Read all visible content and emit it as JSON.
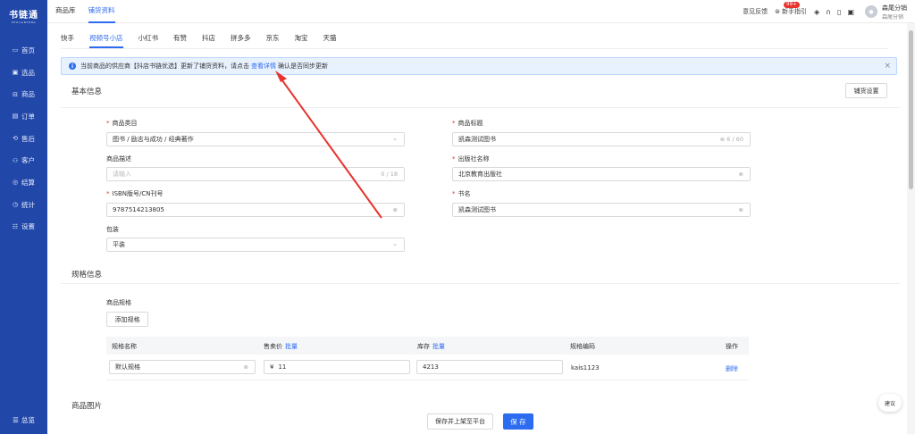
{
  "sidebar": {
    "logo": "书链通",
    "logo_sub": "SHULIANTONG",
    "items": [
      {
        "icon": "monitor-icon",
        "glyph": "▭",
        "label": "首页"
      },
      {
        "icon": "select-icon",
        "glyph": "▣",
        "label": "选品"
      },
      {
        "icon": "goods-icon",
        "glyph": "⊟",
        "label": "商品"
      },
      {
        "icon": "order-icon",
        "glyph": "▤",
        "label": "订单"
      },
      {
        "icon": "aftersale-icon",
        "glyph": "⟲",
        "label": "售后"
      },
      {
        "icon": "customer-icon",
        "glyph": "⚇",
        "label": "客户"
      },
      {
        "icon": "settle-icon",
        "glyph": "◎",
        "label": "结算"
      },
      {
        "icon": "stats-icon",
        "glyph": "◷",
        "label": "统计"
      },
      {
        "icon": "settings-icon",
        "glyph": "☷",
        "label": "设置"
      }
    ],
    "bottom": {
      "icon": "menu-icon",
      "glyph": "☰",
      "label": "总览"
    }
  },
  "topbar": {
    "nav": [
      "商品库",
      "铺货资料"
    ],
    "feedback": "意见反馈",
    "guide": "新手指引",
    "badge": "99+",
    "user_name": "森尾分销",
    "user_role": "森尾分销"
  },
  "tabs": [
    "快手",
    "视频号小店",
    "小红书",
    "有赞",
    "抖店",
    "拼多多",
    "京东",
    "淘宝",
    "天猫"
  ],
  "notice": {
    "before": "当前商品的供应商【抖店书链优选】更新了铺货资料，请点击",
    "link": "查看详情",
    "after": "确认是否同步更新"
  },
  "basic": {
    "title": "基本信息",
    "settings_button": "铺货设置",
    "category_label": "商品类目",
    "category_value": "图书 / 励志与成功 / 经典著作",
    "title_label": "商品标题",
    "title_value": "凯森测试图书",
    "title_count": "6 / 60",
    "desc_label": "商品描述",
    "desc_placeholder": "请输入",
    "desc_count": "0 / 18",
    "publisher_label": "出版社名称",
    "publisher_value": "北京教育出版社",
    "isbn_label": "ISBN版号/CN刊号",
    "isbn_value": "9787514213805",
    "bookname_label": "书名",
    "bookname_value": "凯森测试图书",
    "binding_label": "包装",
    "binding_value": "平装"
  },
  "spec": {
    "title": "规格信息",
    "spec_label": "商品规格",
    "add_button": "添加规格",
    "headers": {
      "name": "规格名称",
      "price": "售卖价",
      "price_batch": "批量",
      "stock": "库存",
      "stock_batch": "批量",
      "code": "规格编码",
      "op": "操作"
    },
    "row": {
      "name": "默认规格",
      "price_prefix": "¥",
      "price": "11",
      "stock": "4213",
      "code": "kais1123",
      "delete": "删除"
    }
  },
  "images": {
    "title": "商品图片"
  },
  "footer": {
    "save_publish": "保存并上架至平台",
    "save": "保 存"
  },
  "float_button": "建议",
  "colors": {
    "sidebar": "#2147a8",
    "primary": "#2d6bf1",
    "required": "#e8342f",
    "arrow": "#e8342f"
  }
}
